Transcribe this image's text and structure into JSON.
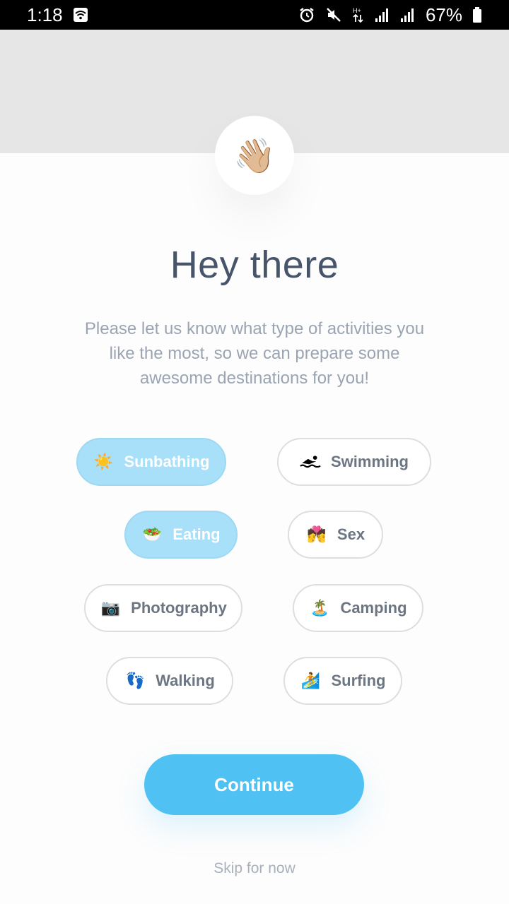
{
  "status_bar": {
    "time": "1:18",
    "battery": "67%",
    "icons": [
      "wifi-icon",
      "alarm-icon",
      "mute-icon",
      "data-arrows-icon",
      "signal-icon",
      "signal-icon",
      "battery-icon"
    ]
  },
  "header": {
    "avatar_emoji": "👋🏼"
  },
  "title": "Hey there",
  "subtitle": "Please let us know what type of activities you like the most, so we can prepare some awesome destinations for you!",
  "activities": [
    {
      "label": "Sunbathing",
      "icon": "☀️",
      "selected": true
    },
    {
      "label": "Swimming",
      "icon": "swimmer-icon",
      "selected": false
    },
    {
      "label": "Eating",
      "icon": "🥗",
      "selected": true
    },
    {
      "label": "Sex",
      "icon": "💏",
      "selected": false
    },
    {
      "label": "Photography",
      "icon": "📷",
      "selected": false
    },
    {
      "label": "Camping",
      "icon": "🏝️",
      "selected": false
    },
    {
      "label": "Walking",
      "icon": "👣",
      "selected": false
    },
    {
      "label": "Surfing",
      "icon": "🏄",
      "selected": false
    }
  ],
  "continue_label": "Continue",
  "skip_label": "Skip for now",
  "colors": {
    "accent": "#4fc2f3",
    "selected_chip": "#a9e0f9",
    "title": "#48546a",
    "subtitle": "#9aa4b2"
  }
}
